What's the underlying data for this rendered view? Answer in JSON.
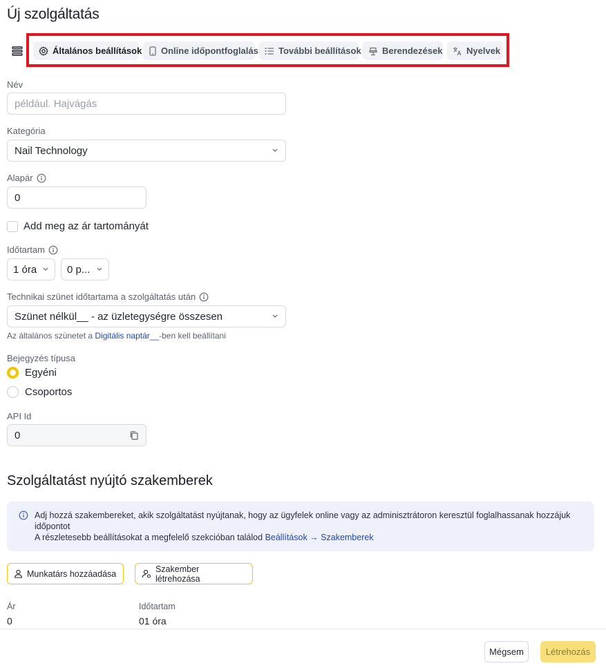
{
  "page": {
    "title": "Új szolgáltatás"
  },
  "tabs": [
    {
      "label": "Általános beállítások",
      "icon": "gear-icon",
      "active": true
    },
    {
      "label": "Online időpontfoglalás",
      "icon": "phone-icon",
      "active": false
    },
    {
      "label": "További beállítások",
      "icon": "list-icon",
      "active": false
    },
    {
      "label": "Berendezések",
      "icon": "chair-icon",
      "active": false
    },
    {
      "label": "Nyelvek",
      "icon": "translate-icon",
      "active": false
    }
  ],
  "form": {
    "name": {
      "label": "Név",
      "placeholder": "például. Hajvágás",
      "value": ""
    },
    "category": {
      "label": "Kategória",
      "value": "Nail Technology"
    },
    "base_price": {
      "label": "Alapár",
      "value": "0"
    },
    "price_range": {
      "label": "Add meg az ár tartományát",
      "checked": false
    },
    "duration": {
      "label": "Időtartam",
      "hours": "1 óra",
      "minutes": "0 p..."
    },
    "technical_break": {
      "label": "Technikai szünet időtartama a szolgáltatás után",
      "value": "Szünet nélkül__ - az üzletegységre összesen",
      "help_prefix": "Az általános szünetet a",
      "help_link": "Digitális naptár__",
      "help_suffix": "-ben kell beállítani"
    },
    "entry_type": {
      "label": "Bejegyzés típusa",
      "options": [
        {
          "label": "Egyéni",
          "selected": true
        },
        {
          "label": "Csoportos",
          "selected": false
        }
      ]
    },
    "api_id": {
      "label": "API Id",
      "value": "0"
    }
  },
  "specialists": {
    "title": "Szolgáltatást nyújtó szakemberek",
    "info_line1": "Adj hozzá szakembereket, akik szolgáltatást nyújtanak, hogy az ügyfelek online vagy az adminisztrátoron keresztül foglalhassanak hozzájuk időpontot",
    "info_line2_prefix": "A részletesebb beállításokat a megfelelő szekcióban találod",
    "info_link": "Beállítások → Szakemberek",
    "add_staff_button": "Munkatárs hozzáadása",
    "create_specialist_button": "Szakember létrehozása",
    "price_label": "Ár",
    "price_value": "0",
    "duration_label": "Időtartam",
    "duration_value": "01 óra"
  },
  "footer": {
    "cancel": "Mégsem",
    "create": "Létrehozás"
  },
  "colors": {
    "accent": "#f5c400",
    "highlight_border": "#e3161f",
    "link": "#1f48b5",
    "info_bg": "#eef0fa"
  }
}
